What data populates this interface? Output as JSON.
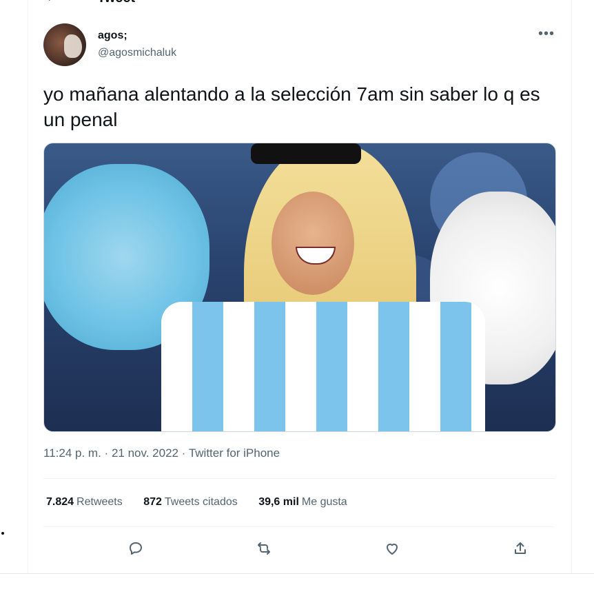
{
  "header": {
    "title": "Tweet",
    "back_icon": "arrow-left-icon"
  },
  "author": {
    "name": "agos;",
    "handle": "@agosmichaluk"
  },
  "tweet": {
    "text": "yo mañana alentando a la selección 7am sin saber lo q es un penal",
    "time": "11:24 p. m.",
    "date": "21 nov. 2022",
    "source": "Twitter for iPhone",
    "sep": "·"
  },
  "stats": {
    "retweets_count": "7.824",
    "retweets_label": "Retweets",
    "quotes_count": "872",
    "quotes_label": "Tweets citados",
    "likes_count": "39,6 mil",
    "likes_label": "Me gusta"
  },
  "actions": [
    "reply-icon",
    "retweet-icon",
    "like-icon",
    "share-icon"
  ],
  "colors": {
    "text": "#0f1419",
    "secondary": "#536471",
    "border": "#eff3f4"
  }
}
